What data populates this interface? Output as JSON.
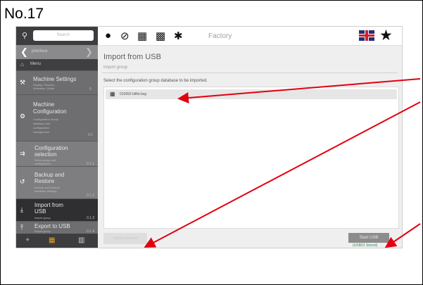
{
  "slide": {
    "label": "No.17"
  },
  "app": {
    "search": {
      "placeholder": "Search"
    },
    "prev_label": "previous",
    "menu_label": "Menu",
    "topbar": {
      "crumb": "Factory"
    },
    "sidebar": {
      "items": [
        {
          "title_lines": [
            "Machine Settings"
          ],
          "desc_lines": [
            "Display, Sensors,",
            "Activation, Guide"
          ],
          "num": "0",
          "icon": "wrench-icon"
        },
        {
          "title_lines": [
            "Machine",
            "Configuration"
          ],
          "desc_lines": [
            "Configuration Group",
            "database and",
            "configuration",
            "management"
          ],
          "num": "0.1",
          "icon": "gear-icon"
        },
        {
          "title_lines": [
            "Configuration",
            "selection"
          ],
          "desc_lines": [
            "Select group and",
            "configuration"
          ],
          "num": "0.1.1",
          "icon": "select-icon"
        },
        {
          "title_lines": [
            "Backup and",
            "Restore"
          ],
          "desc_lines": [
            "Backup and Restore",
            "database settings"
          ],
          "num": "0.1.2",
          "icon": "backup-icon"
        },
        {
          "title_lines": [
            "Import from",
            "USB"
          ],
          "desc_lines": [
            "Import group"
          ],
          "num": "0.1.3",
          "icon": "import-icon"
        },
        {
          "title_lines": [
            "Export to USB"
          ],
          "desc_lines": [
            "Export group"
          ],
          "num": "0.1.4",
          "icon": "export-icon"
        }
      ]
    },
    "main": {
      "title": "Import from USB",
      "subtitle": "Import group",
      "instruction": "Select the configuration group database to be imported.",
      "file": "010993 bilfet.bsg",
      "left_button": "Import selected",
      "right_button": "Start USB",
      "right_note": "(USB01 Stored)"
    }
  },
  "colors": {
    "annotation_arrow": "#e3000f",
    "sidebar_active": "#2f2f31"
  }
}
